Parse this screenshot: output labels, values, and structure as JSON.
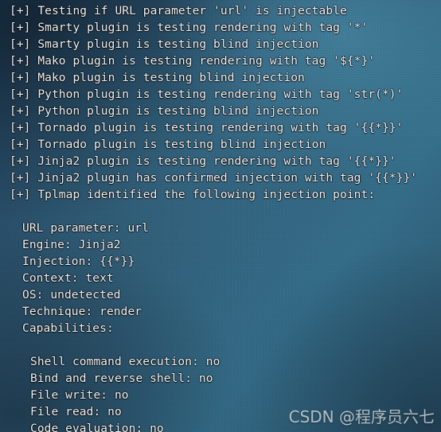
{
  "terminal": {
    "app": "tplmap",
    "prompt_prefix": "[+]",
    "lines": [
      {
        "indent": 0,
        "text": "[+] Testing if URL parameter 'url' is injectable"
      },
      {
        "indent": 0,
        "text": "[+] Smarty plugin is testing rendering with tag '*'"
      },
      {
        "indent": 0,
        "text": "[+] Smarty plugin is testing blind injection"
      },
      {
        "indent": 0,
        "text": "[+] Mako plugin is testing rendering with tag '${*}'"
      },
      {
        "indent": 0,
        "text": "[+] Mako plugin is testing blind injection"
      },
      {
        "indent": 0,
        "text": "[+] Python plugin is testing rendering with tag 'str(*)'"
      },
      {
        "indent": 0,
        "text": "[+] Python plugin is testing blind injection"
      },
      {
        "indent": 0,
        "text": "[+] Tornado plugin is testing rendering with tag '{{*}}'"
      },
      {
        "indent": 0,
        "text": "[+] Tornado plugin is testing blind injection"
      },
      {
        "indent": 0,
        "text": "[+] Jinja2 plugin is testing rendering with tag '{{*}}'"
      },
      {
        "indent": 0,
        "text": "[+] Jinja2 plugin has confirmed injection with tag '{{*}}'"
      },
      {
        "indent": 0,
        "text": "[+] Tplmap identified the following injection point:"
      },
      {
        "indent": 0,
        "text": ""
      },
      {
        "indent": 1,
        "text": "URL parameter: url"
      },
      {
        "indent": 1,
        "text": "Engine: Jinja2"
      },
      {
        "indent": 1,
        "text": "Injection: {{*}}"
      },
      {
        "indent": 1,
        "text": "Context: text"
      },
      {
        "indent": 1,
        "text": "OS: undetected"
      },
      {
        "indent": 1,
        "text": "Technique: render"
      },
      {
        "indent": 1,
        "text": "Capabilities:"
      },
      {
        "indent": 1,
        "text": ""
      },
      {
        "indent": 2,
        "text": "Shell command execution: no"
      },
      {
        "indent": 2,
        "text": "Bind and reverse shell: no"
      },
      {
        "indent": 2,
        "text": "File write: no"
      },
      {
        "indent": 2,
        "text": "File read: no"
      },
      {
        "indent": 2,
        "text": "Code evaluation: no"
      }
    ],
    "injection_point": {
      "url_parameter_label": "URL parameter",
      "url_parameter_value": "url",
      "engine_label": "Engine",
      "engine_value": "Jinja2",
      "injection_label": "Injection",
      "injection_value": "{{*}}",
      "context_label": "Context",
      "context_value": "text",
      "os_label": "OS",
      "os_value": "undetected",
      "technique_label": "Technique",
      "technique_value": "render",
      "capabilities_label": "Capabilities",
      "capabilities": [
        {
          "name": "Shell command execution",
          "value": "no"
        },
        {
          "name": "Bind and reverse shell",
          "value": "no"
        },
        {
          "name": "File write",
          "value": "no"
        },
        {
          "name": "File read",
          "value": "no"
        },
        {
          "name": "Code evaluation",
          "value": "no"
        }
      ]
    },
    "plugins_tested": [
      "Smarty",
      "Mako",
      "Python",
      "Tornado",
      "Jinja2"
    ],
    "tags": {
      "Smarty": "*",
      "Mako": "${*}",
      "Python": "str(*)",
      "Tornado": "{{*}}",
      "Jinja2": "{{*}}"
    },
    "colors": {
      "text": "#f4f5f6",
      "background_dark": "#21405a",
      "background_light": "#336a85",
      "watermark": "#e9eef1"
    }
  },
  "watermark": {
    "text": "CSDN @程序员六七"
  }
}
